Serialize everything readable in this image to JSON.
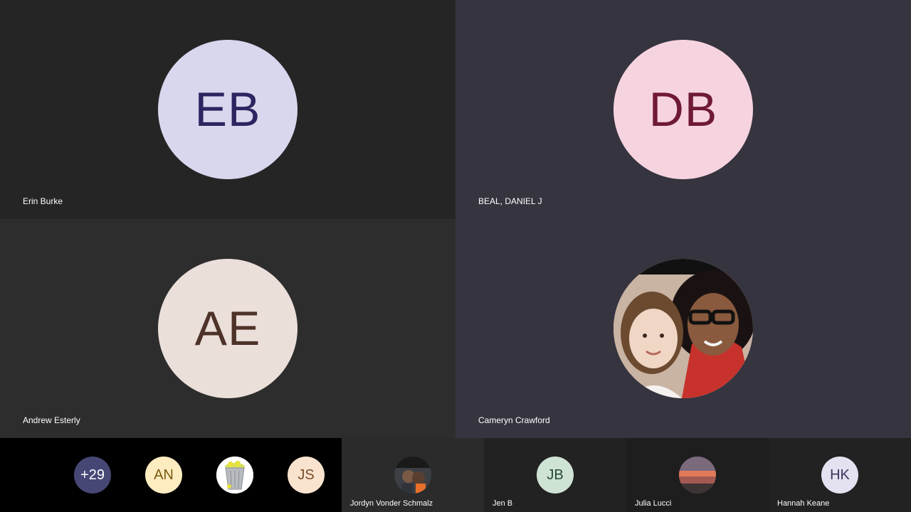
{
  "stage": {
    "tiles": [
      {
        "initials": "EB",
        "name": "Erin Burke"
      },
      {
        "initials": "DB",
        "name": "BEAL, DANIEL J"
      },
      {
        "initials": "AE",
        "name": "Andrew Esterly"
      },
      {
        "initials": "",
        "name": "Cameryn Crawford"
      }
    ]
  },
  "strip": {
    "overflow": {
      "count": "+29",
      "avatars": [
        "AN",
        "",
        "JS"
      ]
    },
    "tiles": [
      {
        "initials": "",
        "name": "Jordyn Vonder Schmalz"
      },
      {
        "initials": "JB",
        "name": "Jen B"
      },
      {
        "initials": "",
        "name": "Julia Lucci"
      },
      {
        "initials": "HK",
        "name": "Hannah Keane"
      }
    ]
  },
  "colors": {
    "eb_bg": "#d8d7ee",
    "eb_fg": "#2b2560",
    "db_bg": "#f6d4df",
    "db_fg": "#6f1a35",
    "ae_bg": "#ebdfda",
    "ae_fg": "#4d3328",
    "more_bg": "#464775",
    "an_bg": "#fcecc0",
    "js_bg": "#f9e3cf",
    "jb_bg": "#cfe3d4",
    "hk_bg": "#e4e2f0"
  }
}
